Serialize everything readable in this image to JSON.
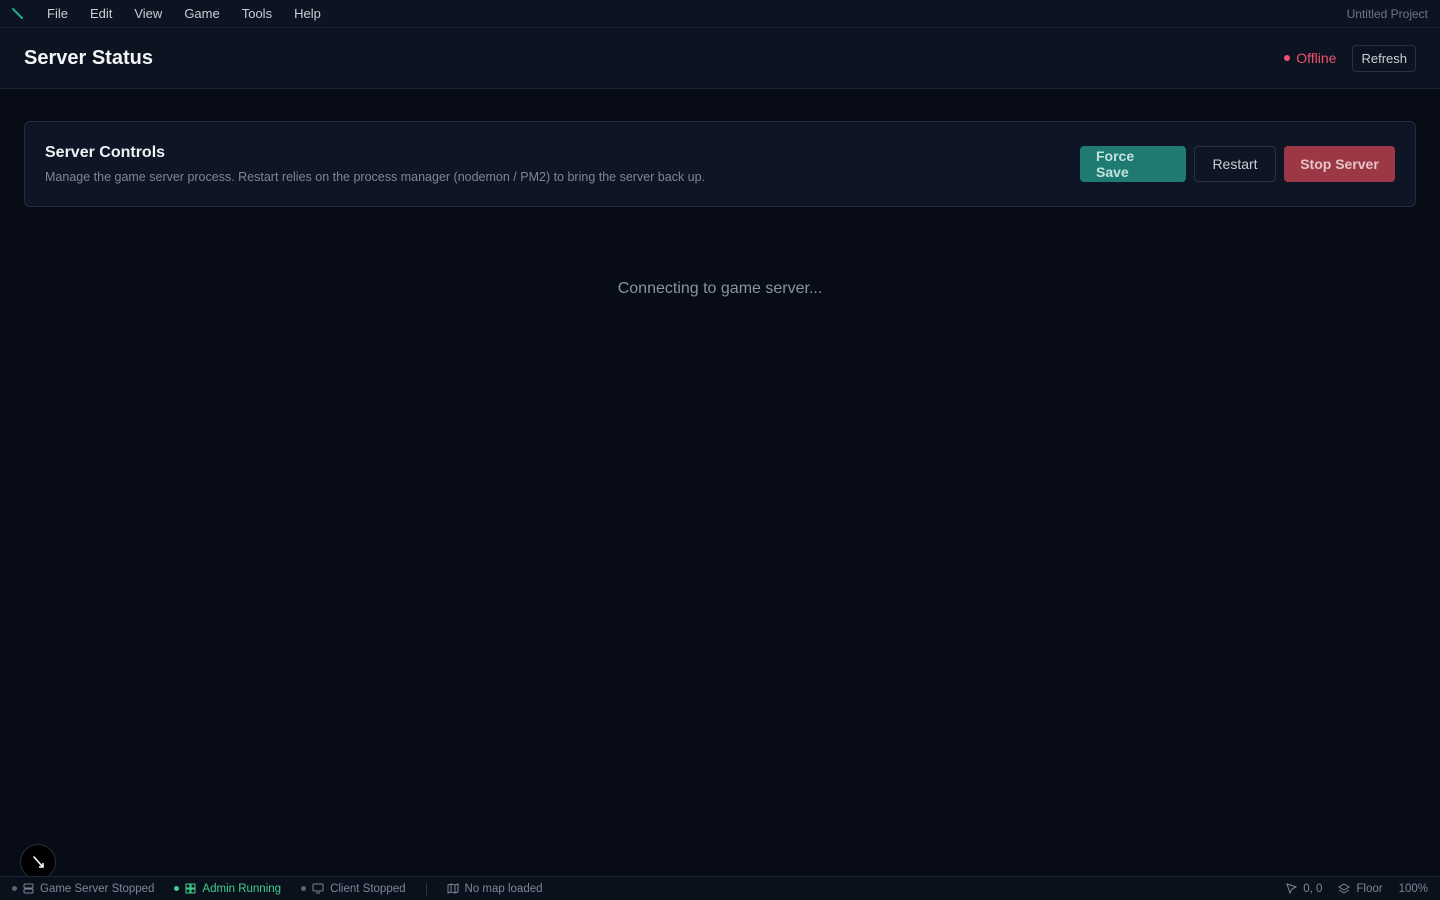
{
  "menubar": {
    "items": [
      "File",
      "Edit",
      "View",
      "Game",
      "Tools",
      "Help"
    ],
    "project": "Untitled Project"
  },
  "header": {
    "title": "Server Status",
    "status": "Offline",
    "refresh_label": "Refresh"
  },
  "controls": {
    "title": "Server Controls",
    "description": "Manage the game server process. Restart relies on the process manager (nodemon / PM2) to bring the server back up.",
    "force_save_label": "Force Save",
    "restart_label": "Restart",
    "stop_label": "Stop Server"
  },
  "connecting_message": "Connecting to game server...",
  "statusbar": {
    "game_server": "Game Server Stopped",
    "admin": "Admin Running",
    "client": "Client Stopped",
    "map": "No map loaded",
    "cursor": "0, 0",
    "layer": "Floor",
    "zoom": "100%"
  },
  "colors": {
    "accent": "#1f7a72",
    "danger": "#9c3845",
    "offline": "#f0506e",
    "running": "#3ecf8e"
  }
}
